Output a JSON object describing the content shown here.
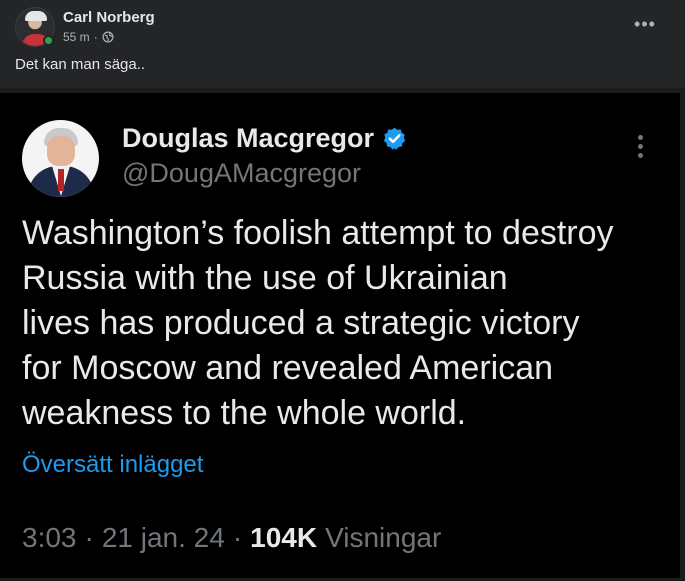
{
  "post": {
    "author": "Carl Norberg",
    "time": "55 m",
    "separator": "·",
    "privacy_icon": "globe-icon",
    "more_label": "•••",
    "text": "Det kan man säga..",
    "online_color": "#31a24c"
  },
  "tweet": {
    "name": "Douglas Macgregor",
    "handle": "@DougAMacgregor",
    "verified_icon": "verified-badge-icon",
    "verified_color": "#1d9bf0",
    "lines": [
      "Washington’s foolish attempt to destroy",
      "Russia with the use of Ukrainian",
      "lives has produced a strategic victory",
      "for Moscow and revealed American",
      "weakness to the whole world."
    ],
    "translate_label": "Översätt inlägget",
    "time": "3:03",
    "date": "21 jan. 24",
    "sep1": "·",
    "sep2": "·",
    "views_count": "104K",
    "views_label": "Visningar"
  }
}
